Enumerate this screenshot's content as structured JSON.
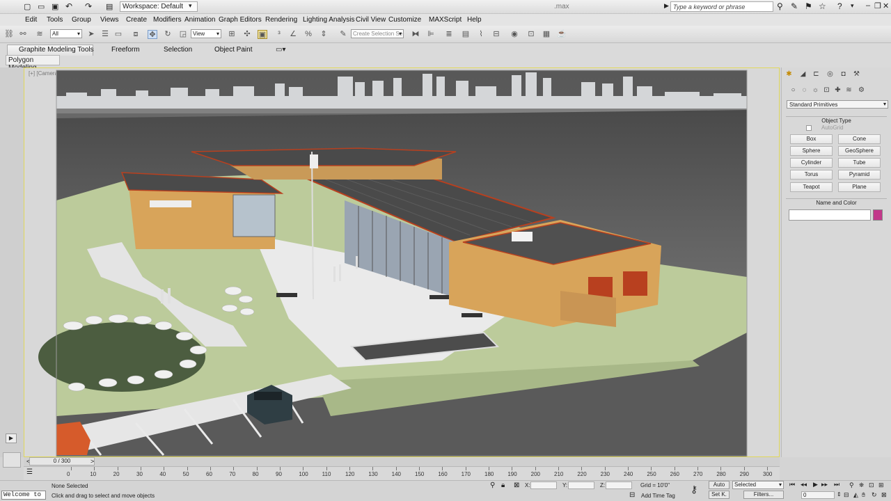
{
  "titlebar": {
    "workspace_label": "Workspace: Default",
    "file_name": ".max",
    "search_placeholder": "Type a keyword or phrase"
  },
  "menu": [
    "Edit",
    "Tools",
    "Group",
    "Views",
    "Create",
    "Modifiers",
    "Animation",
    "Graph Editors",
    "Rendering",
    "Lighting Analysis",
    "Civil View",
    "Customize",
    "MAXScript",
    "Help"
  ],
  "toolbar": {
    "filter_value": "All",
    "refcoord_value": "View",
    "selection_set_placeholder": "Create Selection Se"
  },
  "ribbon": {
    "tabs": [
      "Graphite Modeling Tools",
      "Freeform",
      "Selection",
      "Object Paint"
    ],
    "active_panel": "Polygon Modeling"
  },
  "viewport": {
    "label": "[+] [Camera A] [Realistic]"
  },
  "command_panel": {
    "category": "Standard Primitives",
    "object_type_title": "Object Type",
    "autogrid_label": "AutoGrid",
    "buttons": [
      "Box",
      "Cone",
      "Sphere",
      "GeoSphere",
      "Cylinder",
      "Tube",
      "Torus",
      "Pyramid",
      "Teapot",
      "Plane"
    ],
    "name_color_title": "Name and Color",
    "object_color": "#c2388a"
  },
  "time": {
    "frame_readout": "0 / 300",
    "ticks": [
      "0",
      "10",
      "20",
      "30",
      "40",
      "50",
      "60",
      "70",
      "80",
      "90",
      "100",
      "110",
      "120",
      "130",
      "140",
      "150",
      "160",
      "170",
      "180",
      "190",
      "200",
      "210",
      "220",
      "230",
      "240",
      "250",
      "260",
      "270",
      "280",
      "290",
      "300"
    ]
  },
  "status": {
    "welcome": "Welcome to",
    "selection": "None Selected",
    "prompt": "Click and drag to select and move objects",
    "x_label": "X:",
    "y_label": "Y:",
    "z_label": "Z:",
    "grid": "Grid = 10'0\"",
    "add_time_tag": "Add Time Tag",
    "auto_key": "Auto",
    "set_key": "Set K.",
    "key_filter": "Selected",
    "filters": "Filters...",
    "current_frame": "0"
  },
  "colors": {
    "viewport_border": "#e1d85a",
    "grass": "#bccb9b",
    "wall": "#d8a45a",
    "door": "#b8401f"
  }
}
